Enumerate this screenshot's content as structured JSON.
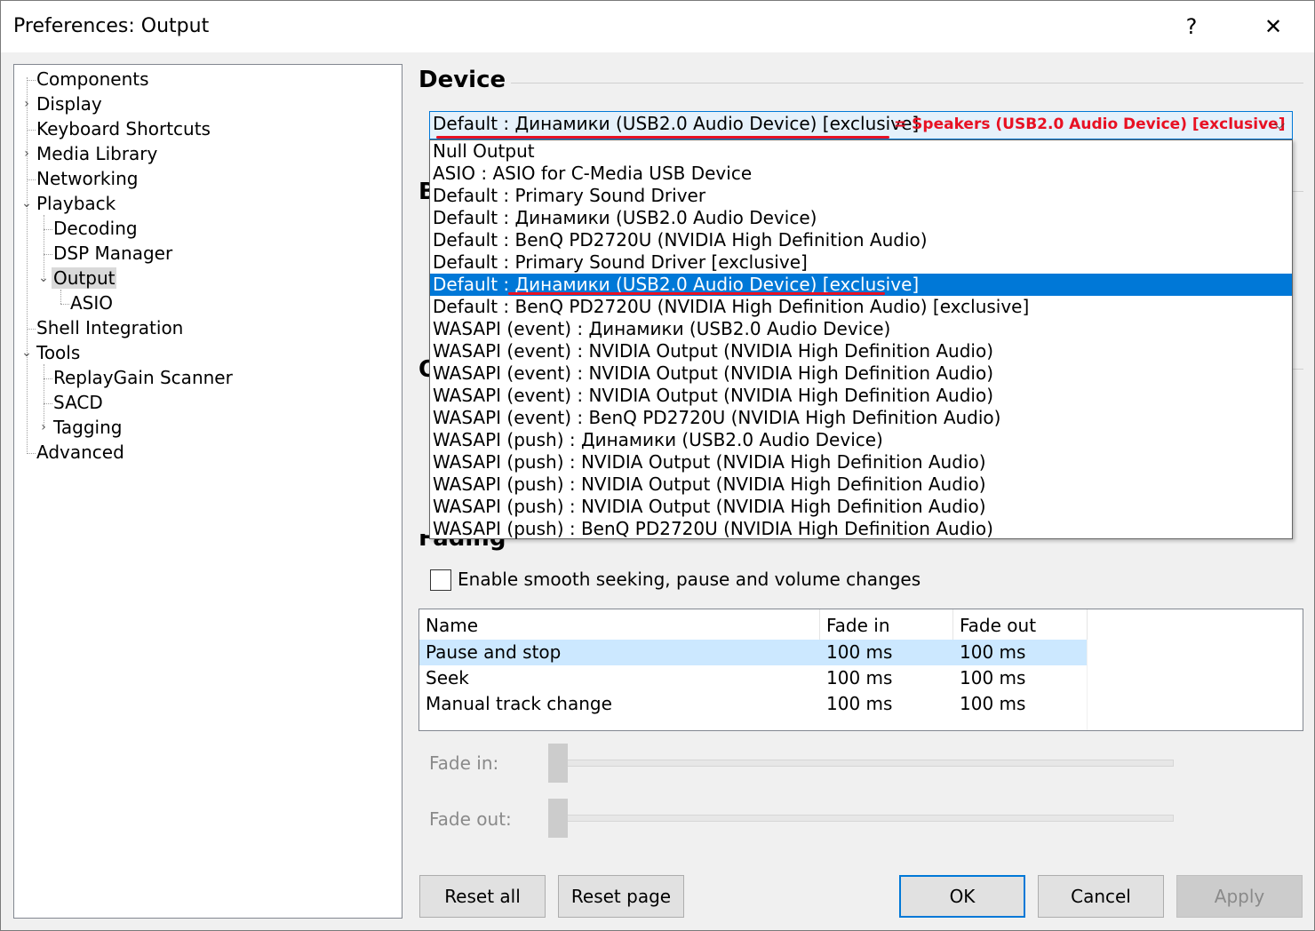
{
  "window": {
    "title": "Preferences: Output",
    "help_label": "?",
    "close_label": "✕"
  },
  "tree": {
    "items": [
      {
        "label": "Components"
      },
      {
        "label": "Display"
      },
      {
        "label": "Keyboard Shortcuts"
      },
      {
        "label": "Media Library"
      },
      {
        "label": "Networking"
      },
      {
        "label": "Playback"
      },
      {
        "label": "Decoding"
      },
      {
        "label": "DSP Manager"
      },
      {
        "label": "Output"
      },
      {
        "label": "ASIO"
      },
      {
        "label": "Shell Integration"
      },
      {
        "label": "Tools"
      },
      {
        "label": "ReplayGain Scanner"
      },
      {
        "label": "SACD"
      },
      {
        "label": "Tagging"
      },
      {
        "label": "Advanced"
      }
    ],
    "selected": "Output"
  },
  "device": {
    "section_title": "Device",
    "selected_value": "Default : Динамики (USB2.0 Audio Device) [exclusive]",
    "annotation": "= Speakers (USB2.0 Audio Device) [exclusive]",
    "options": [
      "Null Output",
      "ASIO : ASIO for C-Media USB Device",
      "Default : Primary Sound Driver",
      "Default : Динамики (USB2.0 Audio Device)",
      "Default : BenQ PD2720U (NVIDIA High Definition Audio)",
      "Default : Primary Sound Driver [exclusive]",
      "Default : Динамики (USB2.0 Audio Device) [exclusive]",
      "Default : BenQ PD2720U (NVIDIA High Definition Audio) [exclusive]",
      "WASAPI (event) : Динамики (USB2.0 Audio Device)",
      "WASAPI (event) : NVIDIA Output (NVIDIA High Definition Audio)",
      "WASAPI (event) : NVIDIA Output (NVIDIA High Definition Audio)",
      "WASAPI (event) : NVIDIA Output (NVIDIA High Definition Audio)",
      "WASAPI (event) : BenQ PD2720U (NVIDIA High Definition Audio)",
      "WASAPI (push) : Динамики (USB2.0 Audio Device)",
      "WASAPI (push) : NVIDIA Output (NVIDIA High Definition Audio)",
      "WASAPI (push) : NVIDIA Output (NVIDIA High Definition Audio)",
      "WASAPI (push) : NVIDIA Output (NVIDIA High Definition Audio)",
      "WASAPI (push) : BenQ PD2720U (NVIDIA High Definition Audio)"
    ],
    "highlighted_index": 6,
    "hidden_section_initial_1": "B",
    "hidden_section_initial_2": "O"
  },
  "fading": {
    "section_title": "Fading",
    "checkbox_label": "Enable smooth seeking, pause and volume changes",
    "checkbox_checked": false,
    "columns": [
      "Name",
      "Fade in",
      "Fade out"
    ],
    "rows": [
      {
        "name": "Pause and stop",
        "fade_in": "100 ms",
        "fade_out": "100 ms"
      },
      {
        "name": "Seek",
        "fade_in": "100 ms",
        "fade_out": "100 ms"
      },
      {
        "name": "Manual track change",
        "fade_in": "100 ms",
        "fade_out": "100 ms"
      }
    ],
    "selected_row": 0,
    "fade_in_label": "Fade in:",
    "fade_out_label": "Fade out:"
  },
  "buttons": {
    "reset_all": "Reset all",
    "reset_page": "Reset page",
    "ok": "OK",
    "cancel": "Cancel",
    "apply": "Apply"
  },
  "colors": {
    "accent": "#0078d7",
    "annotation": "#e81123",
    "selected_row": "#cce8ff"
  }
}
